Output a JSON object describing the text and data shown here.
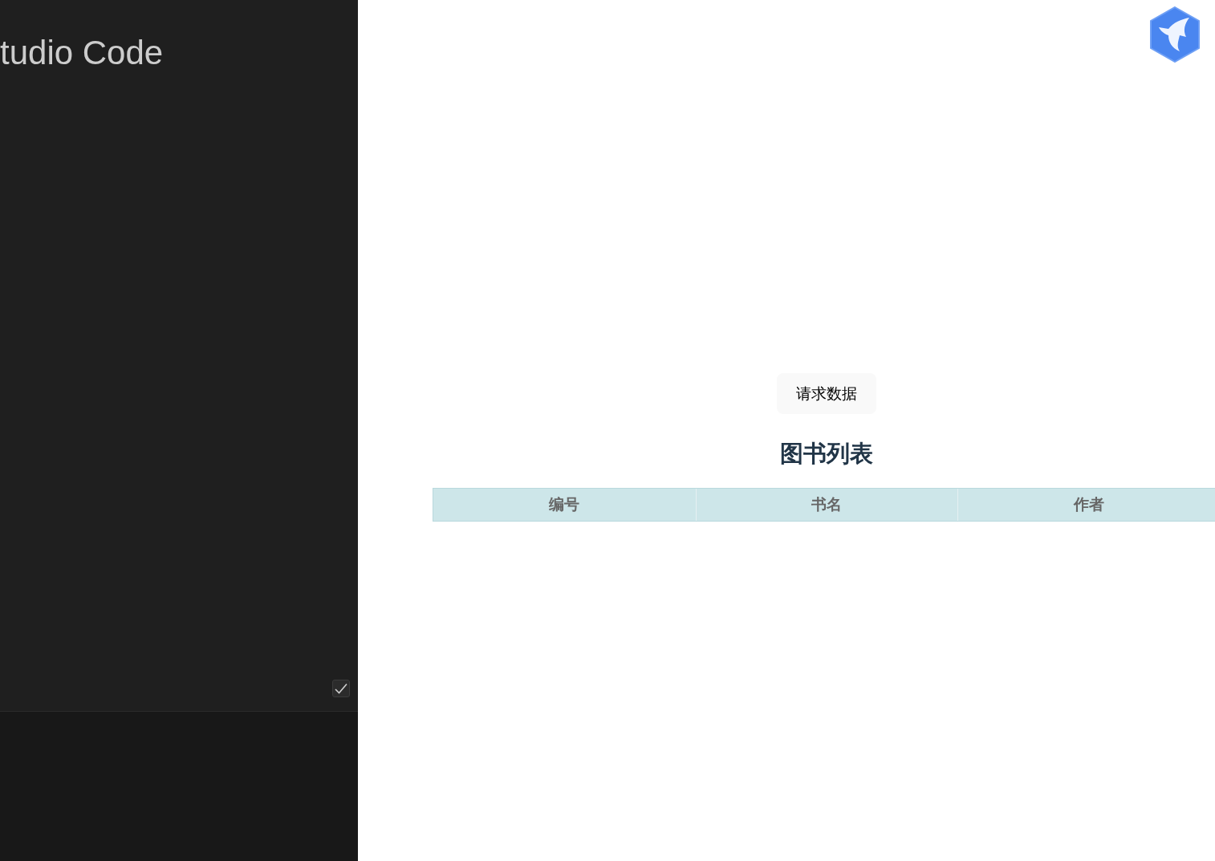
{
  "editor": {
    "title": "tudio Code",
    "checkbox": {
      "checked": true
    }
  },
  "page": {
    "button": "请求数据",
    "heading": "图书列表",
    "table": {
      "columns": [
        "编号",
        "书名",
        "作者"
      ]
    }
  }
}
